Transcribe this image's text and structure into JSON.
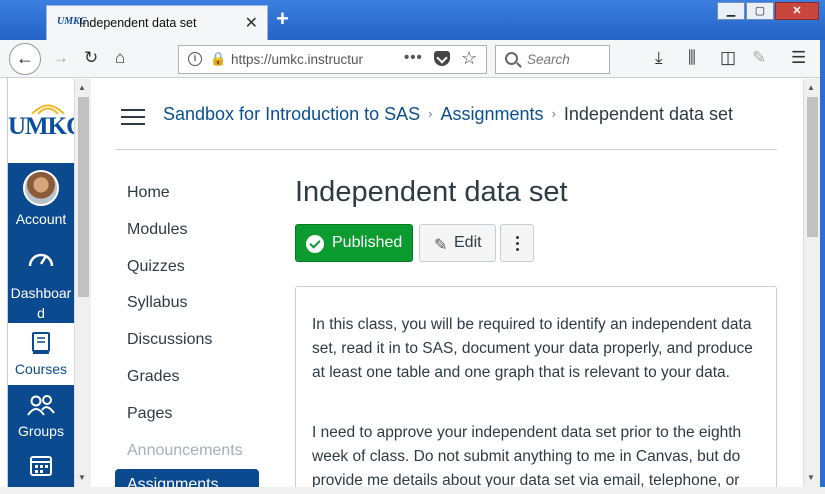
{
  "browser": {
    "tab_title": "Independent data set",
    "tab_favicon": "UMKC",
    "url": "https://umkc.instructur",
    "search_placeholder": "Search",
    "url_menu": "•••"
  },
  "global_nav": {
    "logo": "UMKC",
    "items": [
      {
        "label": "Account",
        "icon": "avatar"
      },
      {
        "label": "Dashboard",
        "label_line1": "Dashboar",
        "label_line2": "d",
        "icon": "dashboard-gauge-icon"
      },
      {
        "label": "Courses",
        "icon": "book-icon"
      },
      {
        "label": "Groups",
        "icon": "groups-icon"
      },
      {
        "label": "Calendar",
        "icon": "calendar-icon"
      }
    ]
  },
  "breadcrumb": {
    "course": "Sandbox for Introduction to SAS",
    "section": "Assignments",
    "current": "Independent data set"
  },
  "course_nav": {
    "items": [
      {
        "label": "Home"
      },
      {
        "label": "Modules"
      },
      {
        "label": "Quizzes"
      },
      {
        "label": "Syllabus"
      },
      {
        "label": "Discussions"
      },
      {
        "label": "Grades"
      },
      {
        "label": "Pages"
      },
      {
        "label": "Announcements",
        "disabled": true
      },
      {
        "label": "Assignments",
        "active": true
      }
    ]
  },
  "assignment": {
    "title": "Independent data set",
    "published_label": "Published",
    "edit_label": "Edit",
    "description": [
      "In this class, you will be required to identify an independent data set, read it in to SAS, document your data properly, and produce at least one table and one graph that is relevant to your data.",
      "I need to approve your independent data set prior to the eighth week of class. Do not submit anything to me in Canvas, but do provide me details about your data set via email, telephone, or"
    ]
  },
  "colors": {
    "canvas_nav": "#0b4a8f",
    "published_green": "#0b9b2e",
    "link": "#0b4f8f",
    "text": "#2d3b45"
  }
}
